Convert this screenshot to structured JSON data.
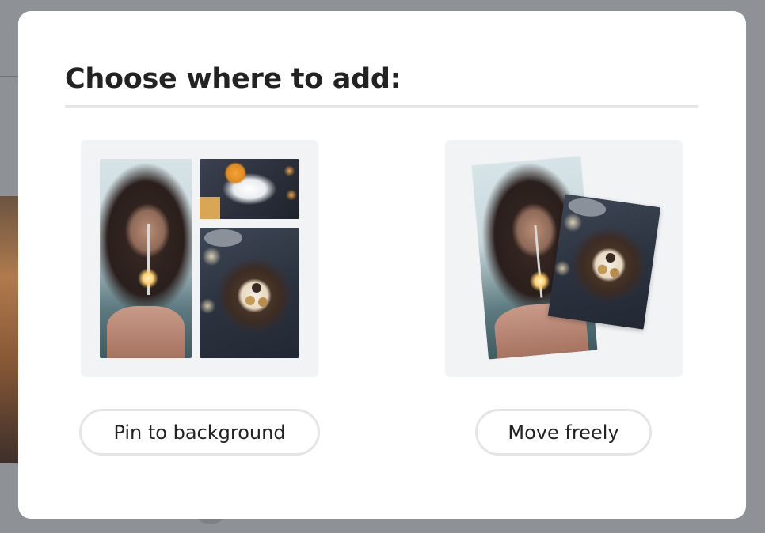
{
  "dialog": {
    "title": "Choose where to add:",
    "options": [
      {
        "id": "pin",
        "label": "Pin to background",
        "preview": "collage-grid-preview"
      },
      {
        "id": "move",
        "label": "Move freely",
        "preview": "free-placement-preview"
      }
    ]
  },
  "colors": {
    "overlay": "#8d9095",
    "dialog_background": "#ffffff",
    "card_background": "#f1f3f5",
    "button_border": "#e5e5e5",
    "text": "#222222"
  }
}
